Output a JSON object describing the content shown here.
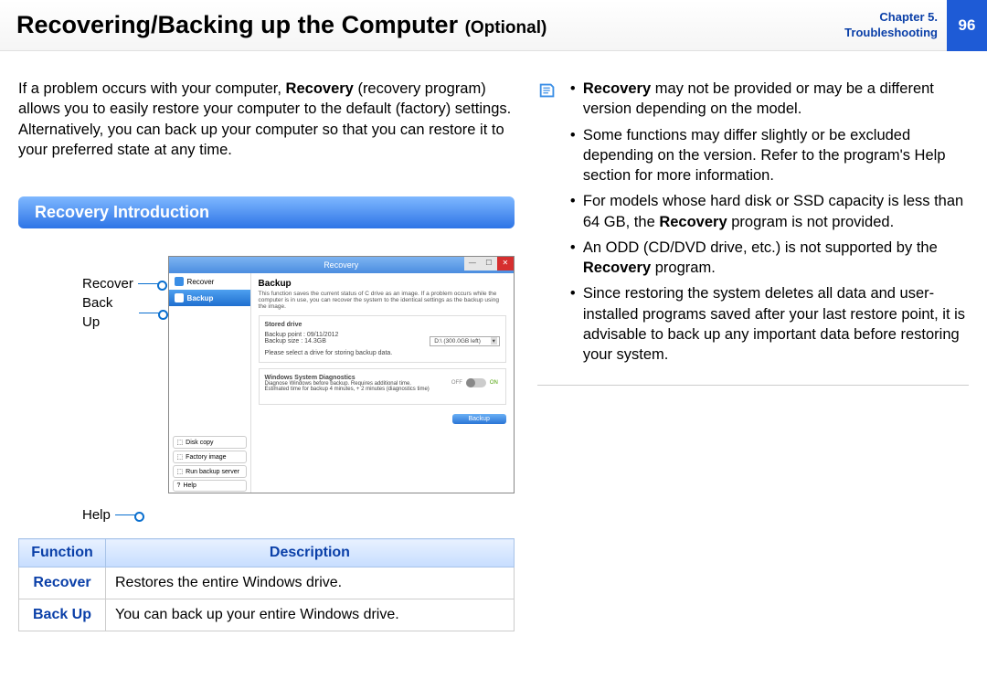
{
  "header": {
    "title": "Recovering/Backing up the Computer",
    "subtitle": "(Optional)",
    "chapter_line1": "Chapter 5.",
    "chapter_line2": "Troubleshooting",
    "page_number": "96"
  },
  "intro": {
    "part1": "If a problem occurs with your computer, ",
    "bold1": "Recovery",
    "part2": " (recovery program) allows you to easily restore your computer to the default (factory) settings. Alternatively, you can back up your computer so that you can restore it to your preferred state at any time."
  },
  "section_heading": "Recovery Introduction",
  "callouts": {
    "recover": "Recover",
    "backup": "Back Up",
    "help": "Help"
  },
  "screenshot": {
    "window_title": "Recovery",
    "side_recover": "Recover",
    "side_backup": "Backup",
    "bottom1": "Disk copy",
    "bottom2": "Factory image",
    "bottom3": "Run backup server",
    "bottom4": "Help",
    "main_heading": "Backup",
    "main_desc": "This function saves the current status of C drive as an image. If a problem occurs while the computer is in use, you can recover the system to the identical settings as the backup using the image.",
    "panel1_title": "Stored drive",
    "panel1_line1": "Backup point : 09/11/2012",
    "panel1_line2": "Backup size : 14.3GB",
    "panel1_line3": "Please select a drive for storing backup data.",
    "panel1_dd": "D:\\ (300.0GB left)",
    "panel2_title": "Windows System Diagnostics",
    "panel2_line1": "Diagnose Windows before backup. Requires additional time.",
    "panel2_line2": "Estimated time for backup 4 minutes, + 2 minutes (diagnostics time)",
    "switch_off": "OFF",
    "switch_on": "ON",
    "main_button": "Backup"
  },
  "table": {
    "head_function": "Function",
    "head_description": "Description",
    "rows": [
      {
        "fn": "Recover",
        "desc": "Restores the entire Windows drive."
      },
      {
        "fn": "Back Up",
        "desc": "You can back up your entire Windows drive."
      }
    ]
  },
  "notes": [
    {
      "prefix_bold": "Recovery",
      "rest": " may not be provided or may be a different version depending on the model."
    },
    {
      "prefix_bold": "",
      "rest": "Some functions may differ slightly or be excluded depending on the version. Refer to the program's Help section for more information."
    },
    {
      "prefix_bold": "",
      "rest_before": "For models whose hard disk or SSD capacity is less than 64 GB, the ",
      "mid_bold": "Recovery",
      "rest_after": " program is not provided."
    },
    {
      "prefix_bold": "",
      "rest_before": "An ODD (CD/DVD drive, etc.) is not supported by the ",
      "mid_bold": "Recovery",
      "rest_after": " program."
    },
    {
      "prefix_bold": "",
      "rest": "Since restoring the system deletes all data and user-installed programs saved after your last restore point, it is advisable to back up any important data before restoring your system."
    }
  ]
}
